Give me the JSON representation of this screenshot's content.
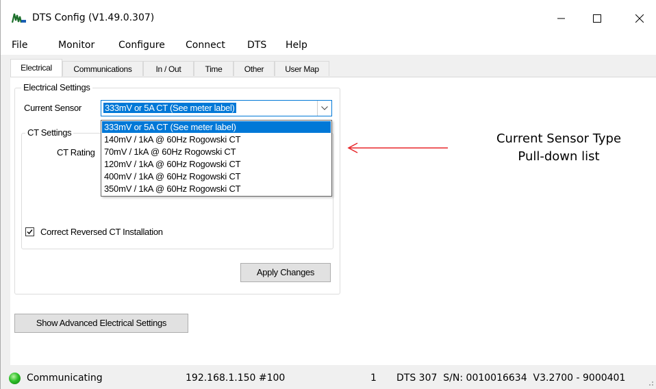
{
  "window": {
    "title": "DTS Config (V1.49.0.307)",
    "controls": {
      "minimize_icon": "minimize-icon",
      "maximize_icon": "maximize-icon",
      "close_icon": "close-icon"
    }
  },
  "menu": [
    "File",
    "Monitor",
    "Configure",
    "Connect",
    "DTS",
    "Help"
  ],
  "tabs": [
    "Electrical",
    "Communications",
    "In / Out",
    "Time",
    "Other",
    "User Map"
  ],
  "active_tab": "Electrical",
  "electrical": {
    "group_label": "Electrical Settings",
    "current_sensor_label": "Current Sensor",
    "current_sensor_value": "333mV or 5A CT (See meter label)",
    "dropdown_options": [
      "333mV or 5A CT (See meter label)",
      "140mV / 1kA @ 60Hz Rogowski CT",
      " 70mV / 1kA @ 60Hz Rogowski CT",
      "120mV / 1kA @ 60Hz Rogowski CT",
      "400mV / 1kA @ 60Hz Rogowski CT",
      "350mV / 1kA @ 60Hz Rogowski CT"
    ],
    "ct_settings_label": "CT Settings",
    "ct_rating_label": "CT Rating",
    "reversed_ct_label": "Correct Reversed CT Installation",
    "reversed_ct_checked": true,
    "apply_button": "Apply Changes",
    "advanced_button": "Show Advanced Electrical Settings"
  },
  "annotation": {
    "line1": "Current Sensor Type",
    "line2": "Pull-down list",
    "arrow_color": "#e8262a"
  },
  "status": {
    "state": "Communicating",
    "address": "192.168.1.150 #100",
    "count": "1",
    "device": "DTS 307  S/N: 0010016634  V3.2700 - 9000401",
    "led_color": "#2fbf2a"
  },
  "colors": {
    "selection": "#0078d7",
    "window_bg": "#f0f0f0"
  }
}
